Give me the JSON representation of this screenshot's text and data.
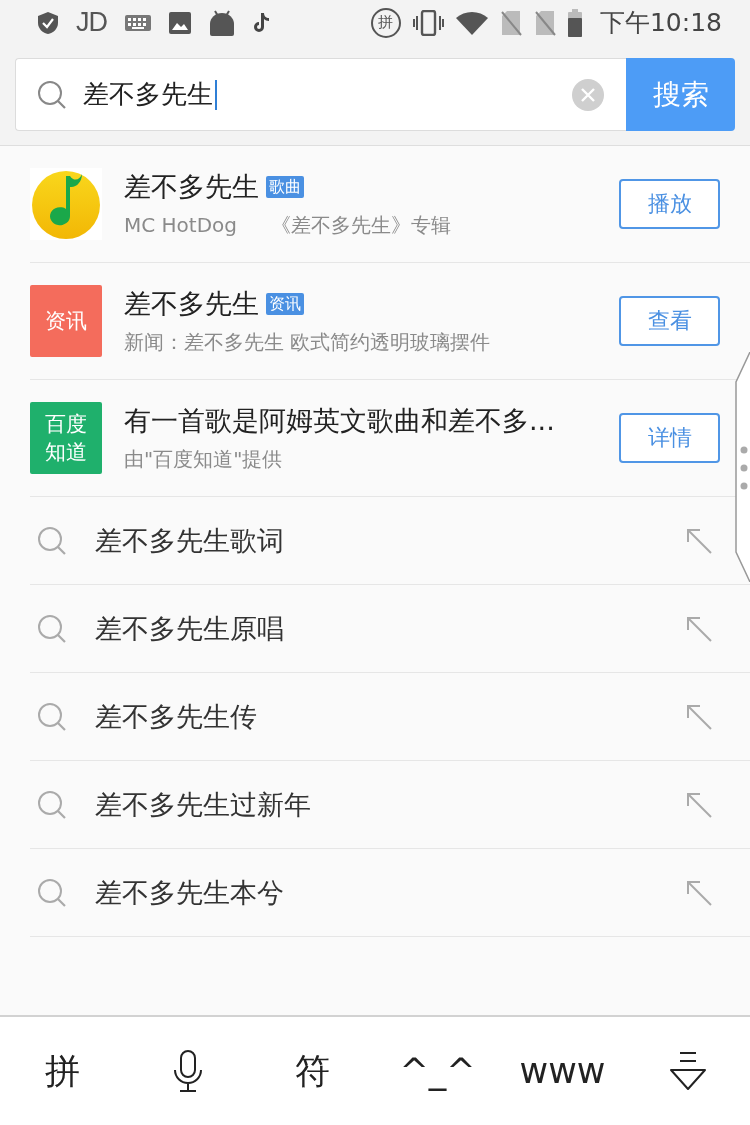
{
  "status_bar": {
    "app_label": "JD",
    "input_badge": "拼",
    "time": "下午10:18"
  },
  "search": {
    "value": "差不多先生",
    "button": "搜索"
  },
  "results": [
    {
      "kind": "song",
      "title": "差不多先生",
      "tag": "歌曲",
      "subtitle": [
        "MC HotDog",
        "《差不多先生》专辑"
      ],
      "action": "播放"
    },
    {
      "kind": "news",
      "tile_lines": [
        "资讯"
      ],
      "title": "差不多先生",
      "tag": "资讯",
      "subtitle": [
        "新闻：差不多先生 欧式简约透明玻璃摆件"
      ],
      "action": "查看"
    },
    {
      "kind": "qa",
      "tile_lines": [
        "百度",
        "知道"
      ],
      "title": "有一首歌是阿姆英文歌曲和差不多...",
      "subtitle": [
        "由\"百度知道\"提供"
      ],
      "action": "详情"
    }
  ],
  "suggestions": [
    "差不多先生歌词",
    "差不多先生原唱",
    "差不多先生传",
    "差不多先生过新年",
    "差不多先生本兮"
  ],
  "keyboard_toolbar": [
    {
      "kind": "text",
      "label": "拼"
    },
    {
      "kind": "voice"
    },
    {
      "kind": "text",
      "label": "符"
    },
    {
      "kind": "text",
      "label": "^_^"
    },
    {
      "kind": "text",
      "label": "www"
    },
    {
      "kind": "collapse"
    }
  ]
}
